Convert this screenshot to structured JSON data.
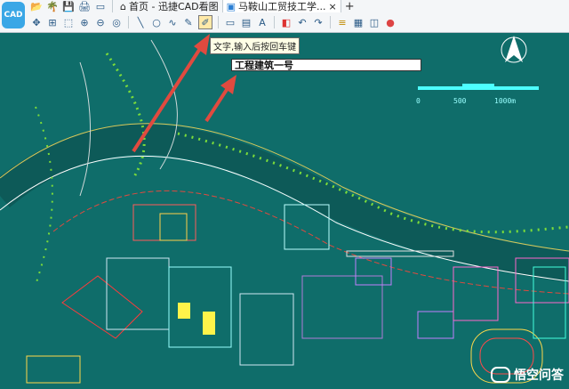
{
  "app": {
    "logo_text": "CAD"
  },
  "tabs": [
    {
      "label": "首页 - 迅捷CAD看图",
      "icon": "home-icon"
    },
    {
      "label": "马鞍山工贸技工学...",
      "icon": "drawing-icon"
    }
  ],
  "tooltip": "文字,输入后按回车键",
  "text_input": {
    "value": "工程建筑一号"
  },
  "scale_labels": [
    "0",
    "500",
    "1000m"
  ],
  "watermark": "悟空问答",
  "colors": {
    "canvas": "#0f6d6a",
    "arrow": "#e04a3f",
    "toolbar": "#f4f6f8"
  },
  "row1_icons": [
    "folder-icon",
    "palm-icon",
    "save-icon",
    "print-icon",
    "window-icon"
  ],
  "row2_icons": [
    "pan-icon",
    "zoom-extents-icon",
    "zoom-window-icon",
    "zoom-in-icon",
    "zoom-out-icon",
    "zoom-fit-icon",
    "line-icon",
    "circle-icon",
    "curve-icon",
    "pencil-icon",
    "text-tool-icon",
    "rect-icon",
    "measure-icon",
    "text-a-icon",
    "eraser-icon",
    "undo-icon",
    "redo-icon",
    "layer-icon",
    "block-icon",
    "3d-icon",
    "color-wheel-icon"
  ]
}
